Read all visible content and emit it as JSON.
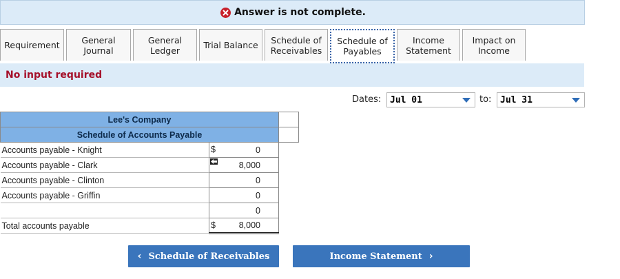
{
  "banner": {
    "message": "Answer is not complete."
  },
  "tabs": [
    {
      "label": "Requirement",
      "active": false
    },
    {
      "label": "General\nJournal",
      "active": false
    },
    {
      "label": "General\nLedger",
      "active": false
    },
    {
      "label": "Trial Balance",
      "active": false
    },
    {
      "label": "Schedule of\nReceivables",
      "active": false
    },
    {
      "label": "Schedule of\nPayables",
      "active": true
    },
    {
      "label": "Income\nStatement",
      "active": false
    },
    {
      "label": "Impact on\nIncome",
      "active": false
    }
  ],
  "notice": "No input required",
  "dates": {
    "label": "Dates:",
    "from": "Jul 01",
    "to_label": "to:",
    "to": "Jul 31"
  },
  "schedule": {
    "company": "Lee's Company",
    "title": "Schedule of Accounts Payable",
    "currency": "$",
    "rows": [
      {
        "account": "Accounts payable - Knight",
        "amount": "0",
        "show_currency": true
      },
      {
        "account": "Accounts payable - Clark",
        "amount": "8,000",
        "flag": true
      },
      {
        "account": "Accounts payable - Clinton",
        "amount": "0"
      },
      {
        "account": "Accounts payable - Griffin",
        "amount": "0"
      },
      {
        "account": "",
        "amount": "0"
      }
    ],
    "total": {
      "label": "Total accounts payable",
      "amount": "8,000"
    }
  },
  "nav": {
    "prev": "Schedule of Receivables",
    "next": "Income Statement"
  },
  "colors": {
    "accent": "#3a75bc",
    "error": "#c8202a",
    "header": "#7fb1e5"
  }
}
